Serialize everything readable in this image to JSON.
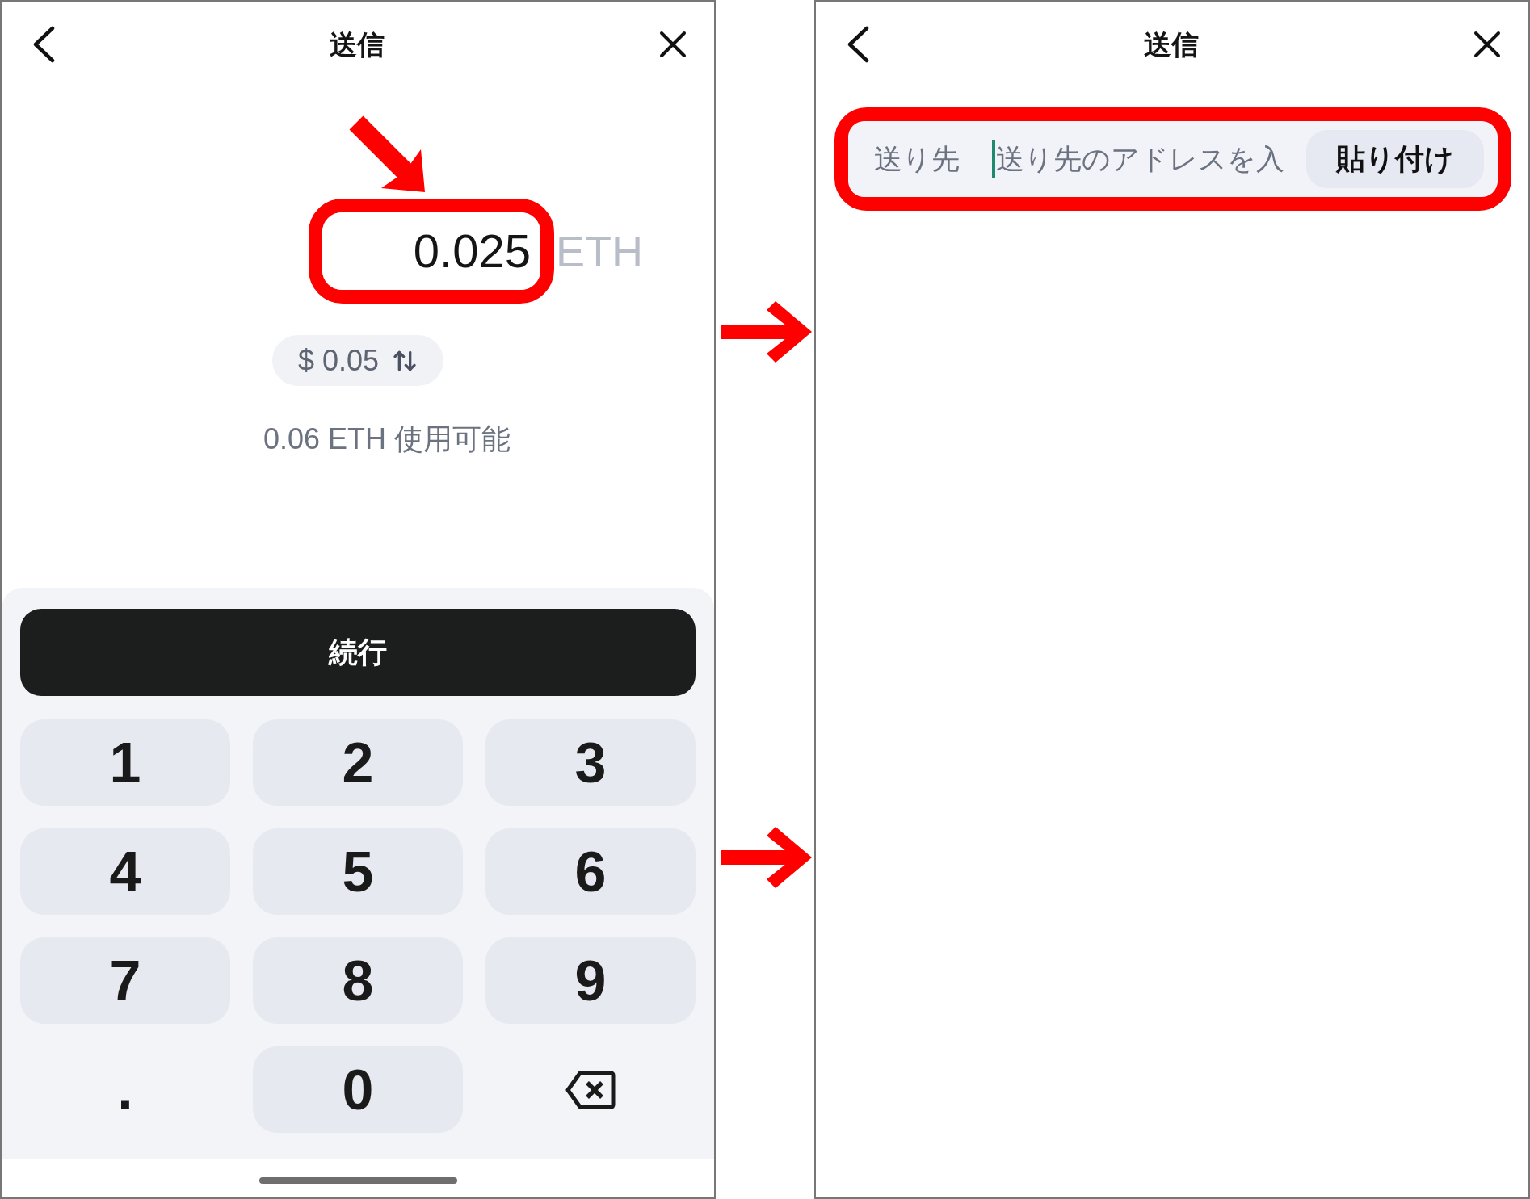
{
  "amount_screen": {
    "title": "送信",
    "amount": {
      "value": "0.025",
      "unit": "ETH",
      "highlighted": true
    },
    "fiat_toggle": {
      "label": "$ 0.05"
    },
    "available": "0.06 ETH 使用可能",
    "continue_button": "続行",
    "keypad": [
      {
        "kind": "digit",
        "label": "1"
      },
      {
        "kind": "digit",
        "label": "2"
      },
      {
        "kind": "digit",
        "label": "3"
      },
      {
        "kind": "digit",
        "label": "4"
      },
      {
        "kind": "digit",
        "label": "5"
      },
      {
        "kind": "digit",
        "label": "6"
      },
      {
        "kind": "digit",
        "label": "7"
      },
      {
        "kind": "digit",
        "label": "8"
      },
      {
        "kind": "digit",
        "label": "9"
      },
      {
        "kind": "symbol",
        "label": "."
      },
      {
        "kind": "digit",
        "label": "0"
      },
      {
        "kind": "backspace"
      }
    ]
  },
  "recipient_screen": {
    "title": "送信",
    "recipient_field": {
      "label": "送り先",
      "placeholder": "送り先のアドレスを入",
      "focused": true,
      "highlighted": true
    },
    "paste_button": "貼り付け"
  }
}
